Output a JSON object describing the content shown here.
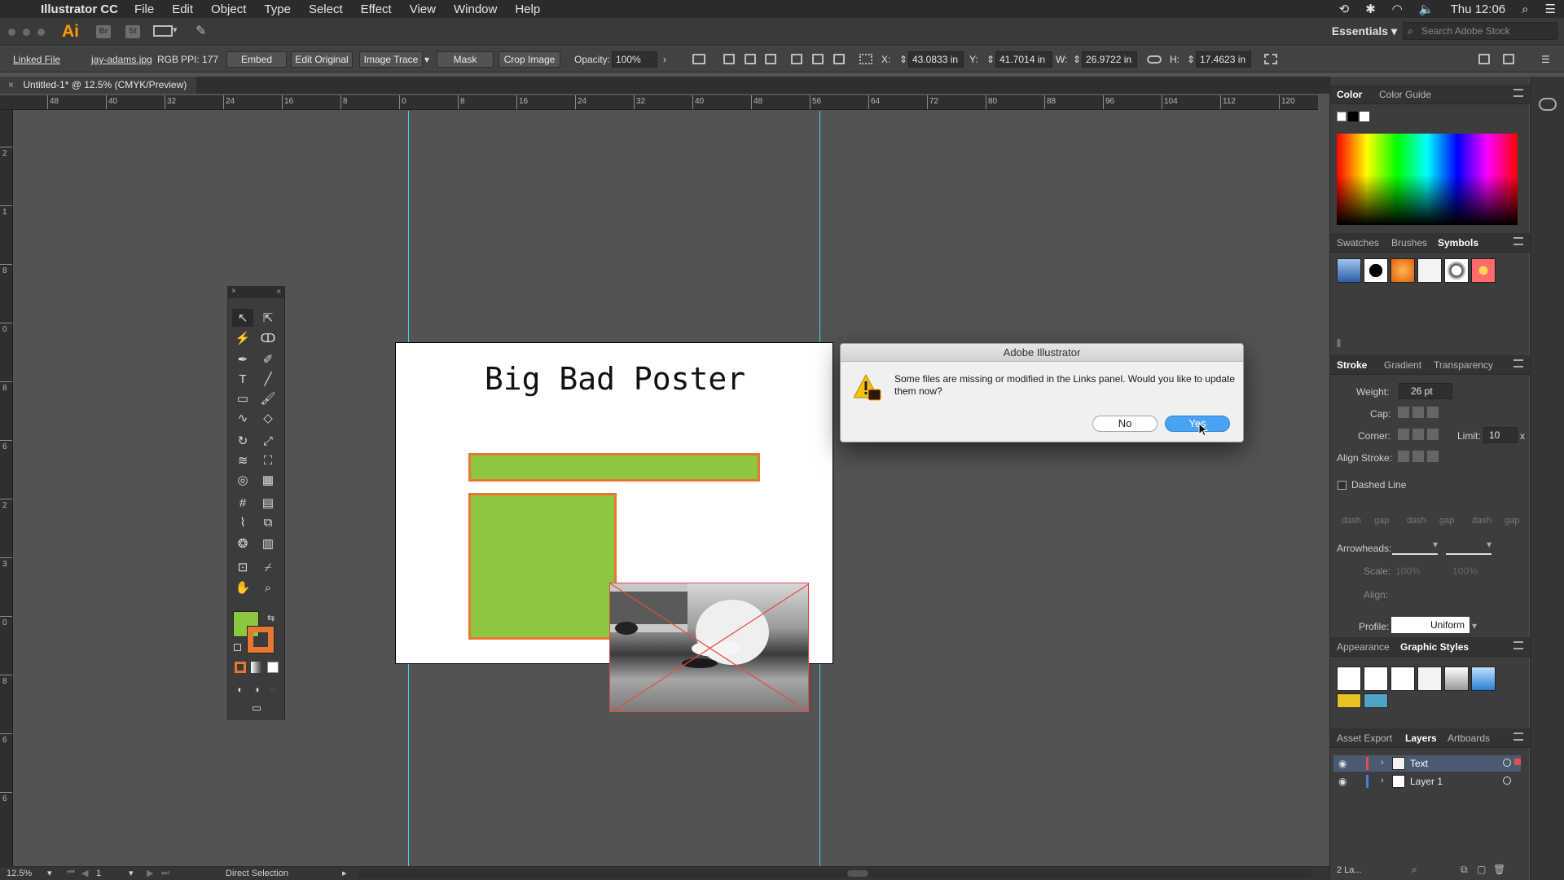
{
  "menubar": {
    "app_name": "Illustrator CC",
    "menus": [
      "File",
      "Edit",
      "Object",
      "Type",
      "Select",
      "Effect",
      "View",
      "Window",
      "Help"
    ],
    "clock": "Thu 12:06"
  },
  "appbar": {
    "logo": "Ai",
    "bridge": "Br",
    "stock": "St",
    "workspace": "Essentials",
    "search_placeholder": "Search Adobe Stock"
  },
  "controlbar": {
    "linked_file_label": "Linked File",
    "filename": "jay-adams.jpg",
    "color_mode": "RGB",
    "ppi": "PPI: 177",
    "embed": "Embed",
    "edit_original": "Edit Original",
    "image_trace": "Image Trace",
    "mask": "Mask",
    "crop_image": "Crop Image",
    "opacity_label": "Opacity:",
    "opacity_value": "100%",
    "x_label": "X:",
    "x_value": "43.0833 in",
    "y_label": "Y:",
    "y_value": "41.7014 in",
    "w_label": "W:",
    "w_value": "26.9722 in",
    "h_label": "H:",
    "h_value": "17.4623 in"
  },
  "document": {
    "tab_title": "Untitled-1* @ 12.5% (CMYK/Preview)",
    "poster_title": "Big Bad Poster"
  },
  "rulers": {
    "top": [
      "48",
      "40",
      "32",
      "24",
      "16",
      "8",
      "0",
      "8",
      "16",
      "24",
      "32",
      "40",
      "48",
      "56",
      "64",
      "72",
      "80",
      "88",
      "96",
      "104",
      "112",
      "120"
    ],
    "left": [
      "2",
      "1",
      "8",
      "0",
      "8",
      "6",
      "2",
      "3",
      "0",
      "8",
      "6",
      "6"
    ]
  },
  "dialog": {
    "title": "Adobe Illustrator",
    "message": "Some files are missing or modified in the Links panel. Would you like to update them now?",
    "no": "No",
    "yes": "Yes"
  },
  "panels": {
    "color_tabs": [
      "Color",
      "Color Guide"
    ],
    "swatch_tabs": [
      "Swatches",
      "Brushes",
      "Symbols"
    ],
    "stroke_tabs": [
      "Stroke",
      "Gradient",
      "Transparency"
    ],
    "stroke": {
      "weight_label": "Weight:",
      "weight_value": "26 pt",
      "cap_label": "Cap:",
      "corner_label": "Corner:",
      "limit_label": "Limit:",
      "limit_value": "10",
      "limit_x": "x",
      "align_label": "Align Stroke:",
      "dashed": "Dashed Line",
      "dash_labels": [
        "dash",
        "gap",
        "dash",
        "gap",
        "dash",
        "gap"
      ],
      "arrowheads_label": "Arrowheads:",
      "scale_label": "Scale:",
      "scale_value_1": "100%",
      "scale_value_2": "100%",
      "align_arrow_label": "Align:",
      "profile_label": "Profile:",
      "profile_value": "Uniform"
    },
    "appearance_tabs": [
      "Appearance",
      "Graphic Styles"
    ],
    "layer_tabs": [
      "Asset Export",
      "Layers",
      "Artboards"
    ],
    "layers": [
      {
        "name": "Text",
        "color": "#e05050"
      },
      {
        "name": "Layer 1",
        "color": "#4f7bd8"
      }
    ],
    "layers_count": "2 La..."
  },
  "status": {
    "zoom": "12.5%",
    "artboard_num": "1",
    "tool": "Direct Selection"
  },
  "colors": {
    "fill": "#8dc63f",
    "stroke": "#e87733",
    "guide": "#3fd2e6",
    "dialog_primary": "#4aa2f2"
  }
}
